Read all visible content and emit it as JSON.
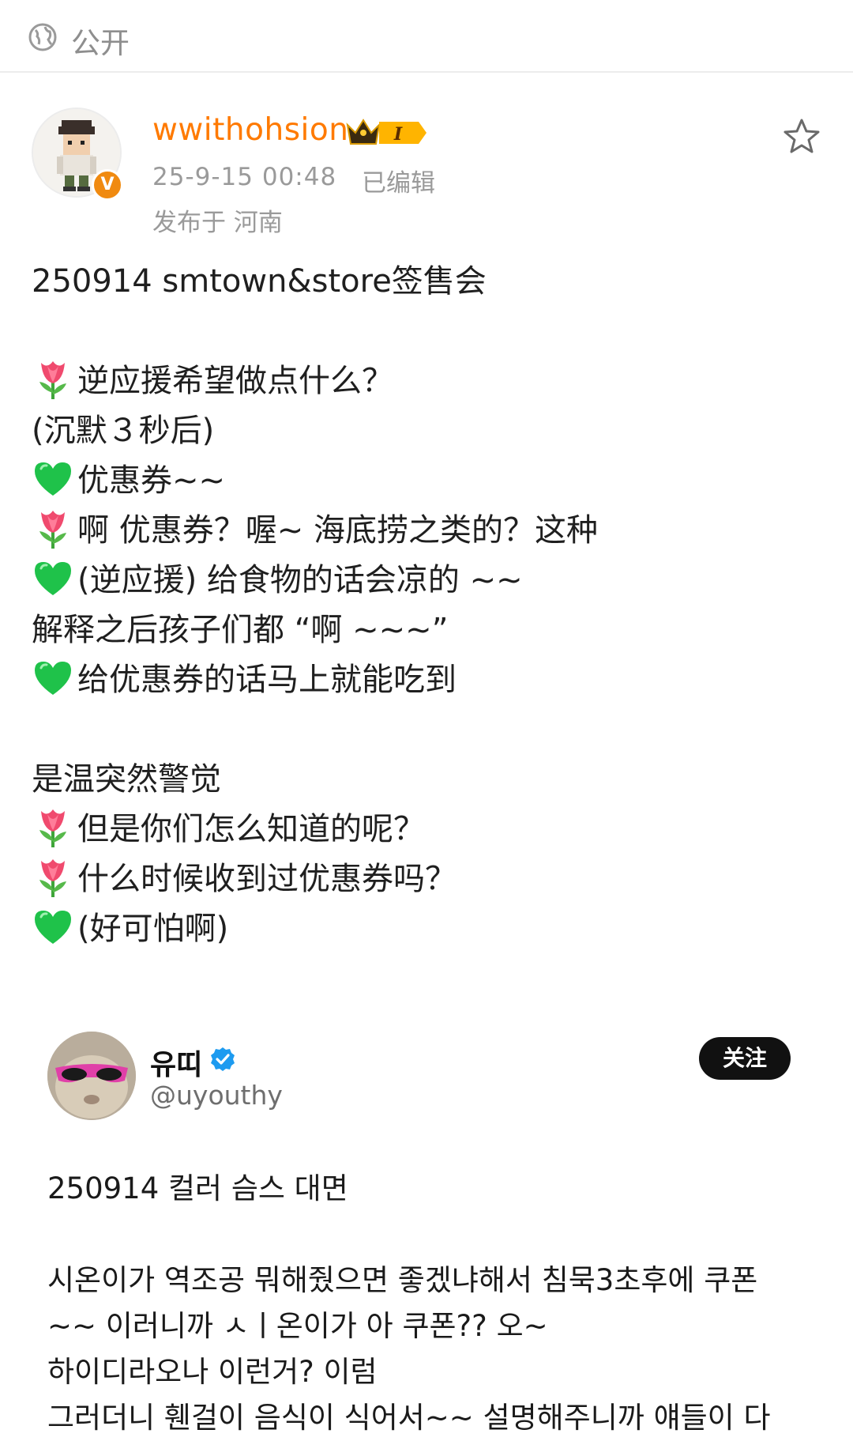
{
  "header": {
    "visibility_label": "公开",
    "icon": "globe-icon"
  },
  "author": {
    "username": "wwithohsion",
    "badge_text": "I",
    "timestamp": "25-9-15 00:48",
    "edited": "已编辑",
    "location": "发布于 河南",
    "verified_mark": "V",
    "colors": {
      "username": "#ff7a00",
      "verified_badge": "#f08a10"
    }
  },
  "post": {
    "lines": [
      {
        "emoji": "",
        "text": "250914 smtown&store签售会"
      },
      {
        "emoji": "",
        "text": ""
      },
      {
        "emoji": "tulip",
        "text": "逆应援希望做点什么？"
      },
      {
        "emoji": "",
        "text": "(沉默３秒后)"
      },
      {
        "emoji": "green-heart",
        "text": "优惠券~~"
      },
      {
        "emoji": "tulip",
        "text": "啊 优惠券？喔~ 海底捞之类的？这种"
      },
      {
        "emoji": "green-heart",
        "text": "(逆应援) 给食物的话会凉的 ~~"
      },
      {
        "emoji": "",
        "text": "解释之后孩子们都 “啊 ~~~”"
      },
      {
        "emoji": "green-heart",
        "text": "给优惠券的话马上就能吃到"
      },
      {
        "emoji": "",
        "text": ""
      },
      {
        "emoji": "",
        "text": "是温突然警觉"
      },
      {
        "emoji": "tulip",
        "text": "但是你们怎么知道的呢？"
      },
      {
        "emoji": "tulip",
        "text": "什么时候收到过优惠券吗？"
      },
      {
        "emoji": "green-heart",
        "text": "(好可怕啊)"
      }
    ]
  },
  "embed": {
    "name": "유띠",
    "handle": "@uyouthy",
    "follow_label": "关注",
    "lines": [
      "250914 컬러 슴스 대면",
      "",
      "시온이가 역조공 뭐해줬으면 좋겠냐해서 침묵3초후에 쿠폰",
      "~~ 이러니까 ㅅㅣ온이가 아 쿠폰?? 오~",
      "하이디라오나 이런거? 이럼",
      "그러더니 휀걸이 음식이 식어서~~ 설명해주니까 얘들이 다"
    ]
  }
}
